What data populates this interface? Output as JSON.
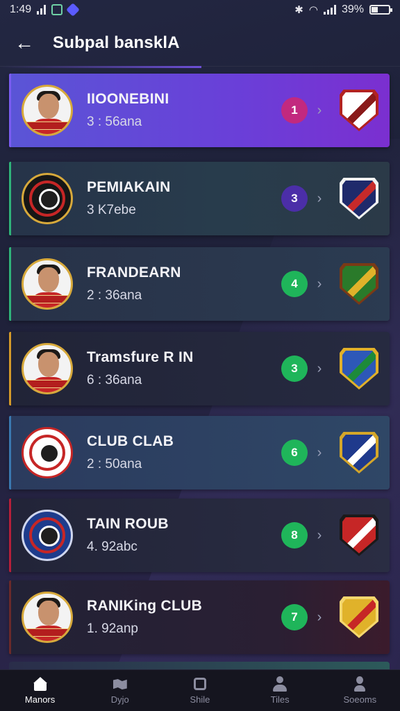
{
  "status_bar": {
    "time": "1:49",
    "battery_text": "39%",
    "battery_fraction": 0.39
  },
  "header": {
    "back_icon": "arrow-left-icon",
    "title": "Subpal bansklA"
  },
  "rows": [
    {
      "name": "IIOONEBINI",
      "score": "3 : 56ana",
      "rank": "1",
      "rank_color": "#c2297f",
      "avatar": "player",
      "accent": "#7a5cf0",
      "club_colors": [
        "#ffffff",
        "#8a1a1a",
        "#b22222"
      ]
    },
    {
      "name": "PEMIAKAIN",
      "score": "3   K7ebe",
      "rank": "3",
      "rank_color": "#4b2ea8",
      "avatar": "crest-dark",
      "accent": "#2fb37a",
      "club_colors": [
        "#1f2a6b",
        "#c62a2a",
        "#f1f1f1"
      ]
    },
    {
      "name": "FRANDEARN",
      "score": "2 : 36ana",
      "rank": "4",
      "rank_color": "#1fb55a",
      "avatar": "player",
      "accent": "#2fb37a",
      "club_colors": [
        "#2a7a2a",
        "#e0b22a",
        "#7a3a16"
      ]
    },
    {
      "name": "Tramsfure R  IN",
      "score": "6 : 36ana",
      "rank": "3",
      "rank_color": "#1fb55a",
      "avatar": "player",
      "accent": "#d49a2a",
      "club_colors": [
        "#2d58b8",
        "#1d8a3a",
        "#e1b02a"
      ]
    },
    {
      "name": "CLUB CLAB",
      "score": "2 : 50ana",
      "rank": "6",
      "rank_color": "#1fb55a",
      "avatar": "crest-red",
      "accent": "#3a78b0",
      "club_colors": [
        "#1f3a8c",
        "#ffffff",
        "#d4a62a"
      ]
    },
    {
      "name": "TAIN ROUB",
      "score": "4.  92abc",
      "rank": "8",
      "rank_color": "#1fb55a",
      "avatar": "crest-navy",
      "accent": "#b51f3a",
      "club_colors": [
        "#c62626",
        "#ffffff",
        "#1a1a1a"
      ]
    },
    {
      "name": "RANIKing CLUB",
      "score": "1. 92anp",
      "rank": "7",
      "rank_color": "#1fb55a",
      "avatar": "player",
      "accent": "#6a2a2a",
      "club_colors": [
        "#e0b22a",
        "#c62626",
        "#f5d76e"
      ]
    }
  ],
  "bottom_nav": [
    {
      "label": "Manors",
      "icon": "home-icon",
      "active": true
    },
    {
      "label": "Dyjo",
      "icon": "map-icon",
      "active": false
    },
    {
      "label": "Shile",
      "icon": "square-icon",
      "active": false
    },
    {
      "label": "Tiles",
      "icon": "person-icon",
      "active": false
    },
    {
      "label": "Soeoms",
      "icon": "profile-icon",
      "active": false
    }
  ]
}
